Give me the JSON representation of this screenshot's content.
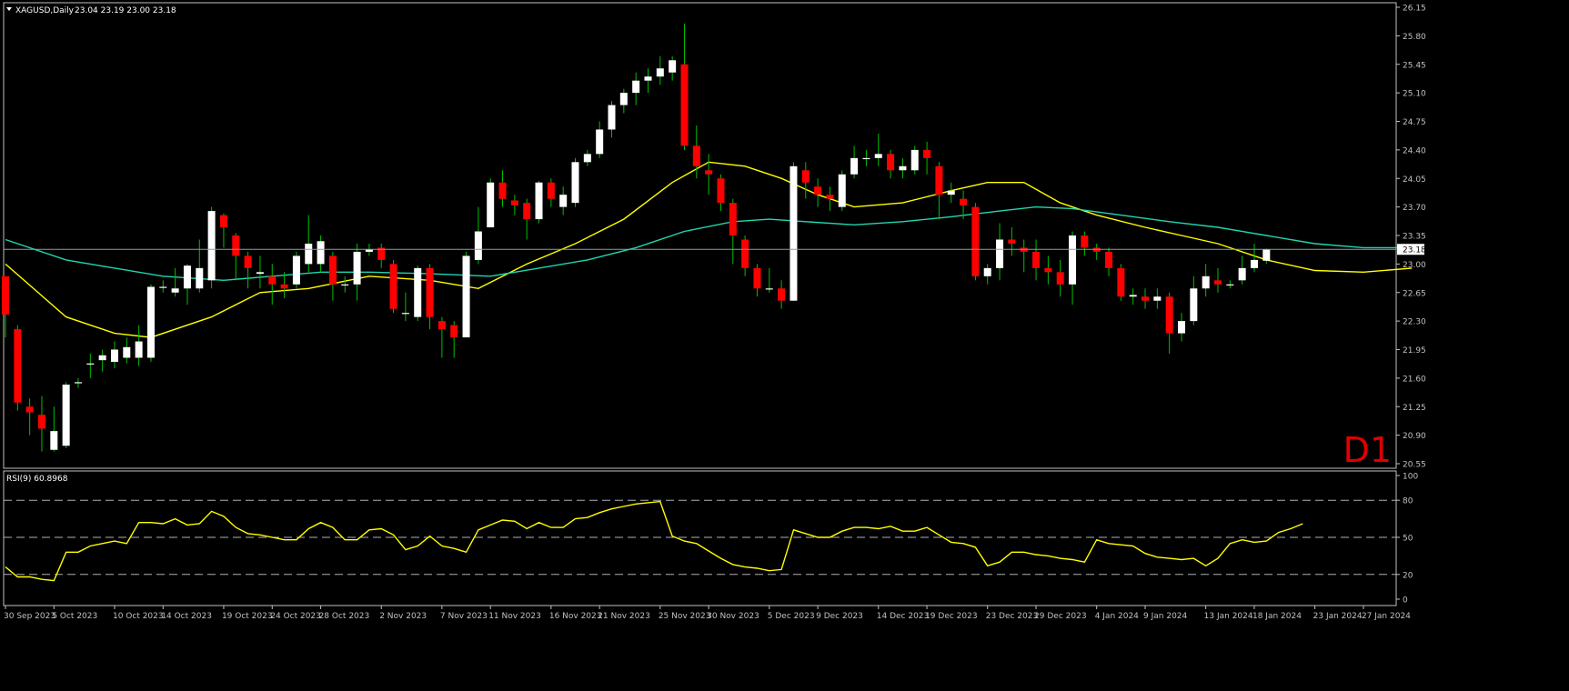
{
  "main_panel": {
    "title": "XAGUSD,Daily",
    "ohlc_text": "23.04 23.19 23.00 23.18",
    "current_price_label": "23.18",
    "timeframe_label": "D1"
  },
  "rsi_panel": {
    "title": "RSI(9) 60.8968"
  },
  "colors": {
    "background": "#000000",
    "grid_axis": "#c0c0c0",
    "bull_candle": "#ffffff",
    "bear_candle": "#ff0000",
    "wick": "#00c000",
    "ma_fast": "#ffff00",
    "ma_slow": "#20d6b0",
    "rsi_line": "#ffff00",
    "timeframe_text": "#e00000"
  },
  "chart_data": [
    {
      "type": "candlestick",
      "symbol": "XAGUSD",
      "timeframe": "Daily",
      "y_ticks": [
        "20.55",
        "20.90",
        "21.25",
        "21.60",
        "21.95",
        "22.30",
        "22.65",
        "23.00",
        "23.35",
        "23.70",
        "24.05",
        "24.40",
        "24.75",
        "25.10",
        "25.45",
        "25.80",
        "26.15"
      ],
      "ylim": [
        20.55,
        26.15
      ],
      "x_tick_labels": [
        {
          "index": 0,
          "label": "30 Sep 2023"
        },
        {
          "index": 4,
          "label": "5 Oct 2023"
        },
        {
          "index": 9,
          "label": "10 Oct 2023"
        },
        {
          "index": 13,
          "label": "14 Oct 2023"
        },
        {
          "index": 18,
          "label": "19 Oct 2023"
        },
        {
          "index": 22,
          "label": "24 Oct 2023"
        },
        {
          "index": 26,
          "label": "28 Oct 2023"
        },
        {
          "index": 31,
          "label": "2 Nov 2023"
        },
        {
          "index": 36,
          "label": "7 Nov 2023"
        },
        {
          "index": 40,
          "label": "11 Nov 2023"
        },
        {
          "index": 45,
          "label": "16 Nov 2023"
        },
        {
          "index": 49,
          "label": "21 Nov 2023"
        },
        {
          "index": 54,
          "label": "25 Nov 2023"
        },
        {
          "index": 58,
          "label": "30 Nov 2023"
        },
        {
          "index": 63,
          "label": "5 Dec 2023"
        },
        {
          "index": 67,
          "label": "9 Dec 2023"
        },
        {
          "index": 72,
          "label": "14 Dec 2023"
        },
        {
          "index": 76,
          "label": "19 Dec 2023"
        },
        {
          "index": 81,
          "label": "23 Dec 2023"
        },
        {
          "index": 85,
          "label": "29 Dec 2023"
        },
        {
          "index": 90,
          "label": "4 Jan 2024"
        },
        {
          "index": 94,
          "label": "9 Jan 2024"
        },
        {
          "index": 99,
          "label": "13 Jan 2024"
        },
        {
          "index": 103,
          "label": "18 Jan 2024"
        },
        {
          "index": 108,
          "label": "23 Jan 2024"
        },
        {
          "index": 112,
          "label": "27 Jan 2024"
        }
      ],
      "candles": [
        [
          22.85,
          22.38,
          22.42,
          22.1
        ],
        [
          22.2,
          21.3,
          22.25,
          21.2
        ],
        [
          21.25,
          21.18,
          21.35,
          20.9
        ],
        [
          21.15,
          20.98,
          21.38,
          20.7
        ],
        [
          20.72,
          20.95,
          21.25,
          20.7
        ],
        [
          20.77,
          21.52,
          21.55,
          20.74
        ],
        [
          21.55,
          21.55,
          21.6,
          21.48
        ],
        [
          21.78,
          21.78,
          21.9,
          21.6
        ],
        [
          21.82,
          21.88,
          21.95,
          21.68
        ],
        [
          21.8,
          21.95,
          22.05,
          21.72
        ],
        [
          21.85,
          21.98,
          22.1,
          21.78
        ],
        [
          21.85,
          22.05,
          22.25,
          21.75
        ],
        [
          21.85,
          22.72,
          22.75,
          21.8
        ],
        [
          22.72,
          22.72,
          22.8,
          22.65
        ],
        [
          22.65,
          22.7,
          22.95,
          22.6
        ],
        [
          22.7,
          22.98,
          23.0,
          22.5
        ],
        [
          22.7,
          22.95,
          23.3,
          22.65
        ],
        [
          22.8,
          23.65,
          23.7,
          22.7
        ],
        [
          23.6,
          23.45,
          23.62,
          23.2
        ],
        [
          23.35,
          23.1,
          23.38,
          22.8
        ],
        [
          23.1,
          22.95,
          23.15,
          22.7
        ],
        [
          22.88,
          22.9,
          23.1,
          22.7
        ],
        [
          22.85,
          22.75,
          23.0,
          22.5
        ],
        [
          22.75,
          22.7,
          22.9,
          22.58
        ],
        [
          22.75,
          23.1,
          23.15,
          22.7
        ],
        [
          23.0,
          23.25,
          23.6,
          22.9
        ],
        [
          23.0,
          23.28,
          23.35,
          22.9
        ],
        [
          23.1,
          22.75,
          23.15,
          22.55
        ],
        [
          22.75,
          22.75,
          22.85,
          22.65
        ],
        [
          22.75,
          23.15,
          23.25,
          22.55
        ],
        [
          23.15,
          23.18,
          23.25,
          23.1
        ],
        [
          23.2,
          23.05,
          23.25,
          22.95
        ],
        [
          23.0,
          22.45,
          23.05,
          22.4
        ],
        [
          22.4,
          22.4,
          22.65,
          22.3
        ],
        [
          22.35,
          22.95,
          22.98,
          22.3
        ],
        [
          22.95,
          22.35,
          23.0,
          22.2
        ],
        [
          22.3,
          22.2,
          22.35,
          21.85
        ],
        [
          22.25,
          22.1,
          22.3,
          21.85
        ],
        [
          22.1,
          23.1,
          23.15,
          22.1
        ],
        [
          23.05,
          23.4,
          23.7,
          23.0
        ],
        [
          23.45,
          24.0,
          24.05,
          23.45
        ],
        [
          24.0,
          23.8,
          24.15,
          23.7
        ],
        [
          23.78,
          23.72,
          23.85,
          23.6
        ],
        [
          23.75,
          23.55,
          23.8,
          23.3
        ],
        [
          23.55,
          24.0,
          24.02,
          23.5
        ],
        [
          24.0,
          23.8,
          24.05,
          23.7
        ],
        [
          23.7,
          23.85,
          23.95,
          23.6
        ],
        [
          23.75,
          24.25,
          24.3,
          23.7
        ],
        [
          24.25,
          24.35,
          24.4,
          24.2
        ],
        [
          24.35,
          24.65,
          24.75,
          24.3
        ],
        [
          24.65,
          24.95,
          25.0,
          24.55
        ],
        [
          24.95,
          25.1,
          25.15,
          24.85
        ],
        [
          25.1,
          25.25,
          25.35,
          24.95
        ],
        [
          25.25,
          25.3,
          25.4,
          25.1
        ],
        [
          25.3,
          25.4,
          25.55,
          25.2
        ],
        [
          25.35,
          25.5,
          25.55,
          25.25
        ],
        [
          25.45,
          24.45,
          25.95,
          24.4
        ],
        [
          24.45,
          24.2,
          24.7,
          24.05
        ],
        [
          24.15,
          24.1,
          24.35,
          23.85
        ],
        [
          24.05,
          23.75,
          24.1,
          23.65
        ],
        [
          23.75,
          23.35,
          23.8,
          23.0
        ],
        [
          23.3,
          22.95,
          23.35,
          22.85
        ],
        [
          22.95,
          22.7,
          23.0,
          22.6
        ],
        [
          22.7,
          22.7,
          22.95,
          22.65
        ],
        [
          22.7,
          22.55,
          22.8,
          22.45
        ],
        [
          22.55,
          24.2,
          24.25,
          22.55
        ],
        [
          24.15,
          24.0,
          24.25,
          23.8
        ],
        [
          23.95,
          23.85,
          24.05,
          23.7
        ],
        [
          23.85,
          23.8,
          23.95,
          23.65
        ],
        [
          23.7,
          24.1,
          24.15,
          23.65
        ],
        [
          24.1,
          24.3,
          24.45,
          24.05
        ],
        [
          24.3,
          24.3,
          24.4,
          24.2
        ],
        [
          24.3,
          24.35,
          24.6,
          24.2
        ],
        [
          24.35,
          24.15,
          24.4,
          24.05
        ],
        [
          24.15,
          24.2,
          24.3,
          24.05
        ],
        [
          24.15,
          24.4,
          24.45,
          24.1
        ],
        [
          24.4,
          24.3,
          24.5,
          24.1
        ],
        [
          24.2,
          23.85,
          24.25,
          23.55
        ],
        [
          23.85,
          23.9,
          24.0,
          23.75
        ],
        [
          23.8,
          23.72,
          23.9,
          23.55
        ],
        [
          23.7,
          22.85,
          23.75,
          22.8
        ],
        [
          22.85,
          22.95,
          23.0,
          22.75
        ],
        [
          22.95,
          23.3,
          23.5,
          22.8
        ],
        [
          23.3,
          23.25,
          23.45,
          23.1
        ],
        [
          23.2,
          23.15,
          23.3,
          22.9
        ],
        [
          23.15,
          22.95,
          23.3,
          22.8
        ],
        [
          22.95,
          22.9,
          23.1,
          22.75
        ],
        [
          22.9,
          22.75,
          23.05,
          22.6
        ],
        [
          22.75,
          23.35,
          23.4,
          22.5
        ],
        [
          23.35,
          23.2,
          23.4,
          23.1
        ],
        [
          23.2,
          23.15,
          23.25,
          23.05
        ],
        [
          23.15,
          22.95,
          23.2,
          22.85
        ],
        [
          22.95,
          22.6,
          23.0,
          22.55
        ],
        [
          22.6,
          22.62,
          22.7,
          22.5
        ],
        [
          22.6,
          22.55,
          22.7,
          22.45
        ],
        [
          22.55,
          22.6,
          22.7,
          22.45
        ],
        [
          22.6,
          22.15,
          22.65,
          21.9
        ],
        [
          22.15,
          22.3,
          22.4,
          22.05
        ],
        [
          22.3,
          22.7,
          22.85,
          22.25
        ],
        [
          22.7,
          22.85,
          23.0,
          22.6
        ],
        [
          22.8,
          22.75,
          22.95,
          22.65
        ],
        [
          22.75,
          22.75,
          22.8,
          22.7
        ],
        [
          22.8,
          22.95,
          23.1,
          22.75
        ],
        [
          22.95,
          23.05,
          23.25,
          22.9
        ],
        [
          23.04,
          23.18,
          23.19,
          23.0
        ]
      ],
      "ma_fast": {
        "color": "#ffff00",
        "points": [
          [
            0,
            23.0
          ],
          [
            5,
            22.35
          ],
          [
            9,
            22.15
          ],
          [
            12,
            22.1
          ],
          [
            17,
            22.35
          ],
          [
            21,
            22.65
          ],
          [
            25,
            22.7
          ],
          [
            30,
            22.85
          ],
          [
            35,
            22.8
          ],
          [
            39,
            22.7
          ],
          [
            43,
            23.0
          ],
          [
            47,
            23.25
          ],
          [
            51,
            23.55
          ],
          [
            55,
            24.0
          ],
          [
            58,
            24.25
          ],
          [
            61,
            24.2
          ],
          [
            64,
            24.05
          ],
          [
            67,
            23.85
          ],
          [
            70,
            23.7
          ],
          [
            74,
            23.75
          ],
          [
            78,
            23.9
          ],
          [
            81,
            24.0
          ],
          [
            84,
            24.0
          ],
          [
            87,
            23.75
          ],
          [
            90,
            23.6
          ],
          [
            94,
            23.45
          ],
          [
            97,
            23.35
          ],
          [
            100,
            23.25
          ],
          [
            104,
            23.05
          ],
          [
            108,
            22.92
          ],
          [
            112,
            22.9
          ],
          [
            116,
            22.95
          ]
        ]
      },
      "ma_slow": {
        "color": "#20d6b0",
        "points": [
          [
            0,
            23.3
          ],
          [
            5,
            23.05
          ],
          [
            9,
            22.95
          ],
          [
            13,
            22.85
          ],
          [
            18,
            22.8
          ],
          [
            22,
            22.85
          ],
          [
            26,
            22.9
          ],
          [
            30,
            22.9
          ],
          [
            35,
            22.88
          ],
          [
            40,
            22.85
          ],
          [
            44,
            22.95
          ],
          [
            48,
            23.05
          ],
          [
            52,
            23.2
          ],
          [
            56,
            23.4
          ],
          [
            60,
            23.52
          ],
          [
            63,
            23.55
          ],
          [
            66,
            23.52
          ],
          [
            70,
            23.48
          ],
          [
            74,
            23.52
          ],
          [
            78,
            23.58
          ],
          [
            82,
            23.65
          ],
          [
            85,
            23.7
          ],
          [
            88,
            23.68
          ],
          [
            92,
            23.6
          ],
          [
            96,
            23.52
          ],
          [
            100,
            23.45
          ],
          [
            104,
            23.35
          ],
          [
            108,
            23.25
          ],
          [
            112,
            23.2
          ],
          [
            116,
            23.2
          ]
        ]
      }
    },
    {
      "type": "line",
      "name": "RSI(9)",
      "ylim": [
        0,
        100
      ],
      "y_ticks": [
        "100",
        "80",
        "50",
        "20",
        "0"
      ],
      "levels": [
        80,
        50,
        20
      ],
      "values": [
        26,
        18,
        18,
        16,
        15,
        38,
        38,
        43,
        45,
        47,
        45,
        62,
        62,
        61,
        65,
        60,
        61,
        71,
        67,
        58,
        53,
        52,
        50,
        48,
        48,
        57,
        62,
        58,
        48,
        48,
        56,
        57,
        52,
        40,
        43,
        51,
        43,
        41,
        38,
        56,
        60,
        64,
        63,
        57,
        62,
        58,
        58,
        65,
        66,
        70,
        73,
        75,
        77,
        78,
        79,
        51,
        47,
        45,
        39,
        33,
        28,
        26,
        25,
        23,
        24,
        56,
        53,
        50,
        50,
        55,
        58,
        58,
        57,
        59,
        55,
        55,
        58,
        52,
        46,
        45,
        42,
        27,
        30,
        38,
        38,
        36,
        35,
        33,
        32,
        30,
        48,
        45,
        44,
        43,
        37,
        34,
        33,
        32,
        33,
        27,
        33,
        45,
        48,
        46,
        47,
        54,
        57,
        61
      ]
    }
  ]
}
